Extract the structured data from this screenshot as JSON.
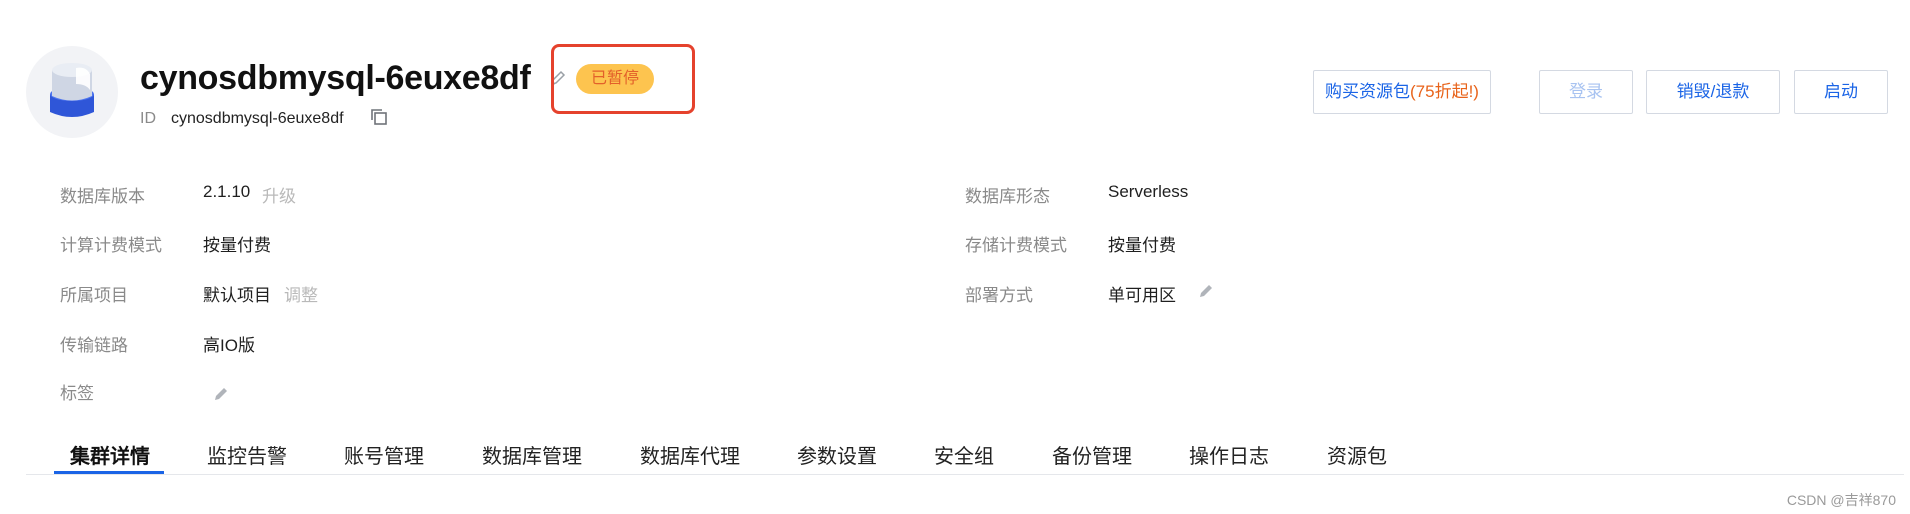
{
  "header": {
    "title": "cynosdbmysql-6euxe8df",
    "status_badge": "已暂停",
    "id_label": "ID",
    "id_value": "cynosdbmysql-6euxe8df",
    "icons": [
      "database-icon",
      "edit-icon",
      "copy-icon"
    ]
  },
  "actions": {
    "buy_label": "购买资源包",
    "buy_promo": "(75折起!)",
    "login_label": "登录",
    "destroy_label": "销毁/退款",
    "start_label": "启动"
  },
  "info": {
    "left": [
      {
        "label": "数据库版本",
        "value": "2.1.10",
        "extra": "升级"
      },
      {
        "label": "计算计费模式",
        "value": "按量付费"
      },
      {
        "label": "所属项目",
        "value": "默认项目",
        "extra": "调整"
      },
      {
        "label": "传输链路",
        "value": "高IO版"
      },
      {
        "label": "标签"
      }
    ],
    "right": [
      {
        "label": "数据库形态",
        "value": "Serverless"
      },
      {
        "label": "存储计费模式",
        "value": "按量付费"
      },
      {
        "label": "部署方式",
        "value": "单可用区"
      }
    ]
  },
  "tabs": [
    "集群详情",
    "监控告警",
    "账号管理",
    "数据库管理",
    "数据库代理",
    "参数设置",
    "安全组",
    "备份管理",
    "操作日志",
    "资源包"
  ],
  "active_tab": "集群详情",
  "watermark": "CSDN @吉祥870",
  "colors": {
    "accent": "#1a64e6",
    "badge_bg": "#fdc44f",
    "badge_text": "#e3602a",
    "highlight": "#e5422d",
    "promo": "#e8631a"
  }
}
